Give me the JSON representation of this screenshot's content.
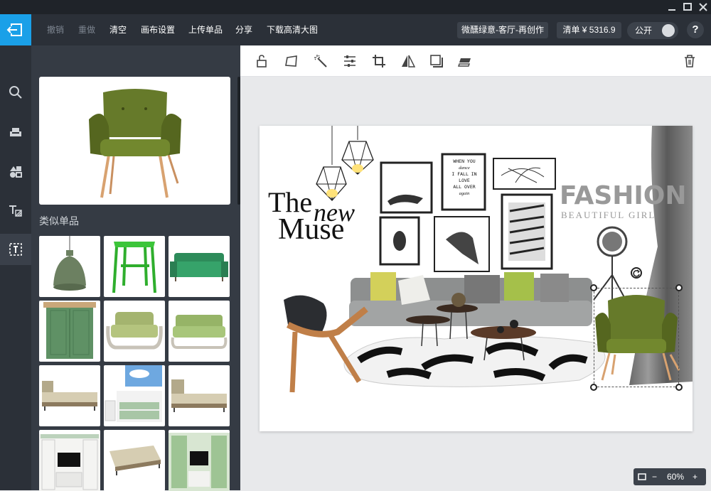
{
  "window": {
    "minimize_icon": "minimize-icon",
    "maximize_icon": "maximize-icon",
    "close_icon": "close-icon"
  },
  "toolbar": {
    "undo": "撤销",
    "redo": "重做",
    "clear": "清空",
    "canvas_settings": "画布设置",
    "upload_item": "上传单品",
    "share": "分享",
    "download_hd": "下载高清大图",
    "project_name": "微醺绿意-客厅-再创作",
    "bill": "清单 ¥ 5316.9",
    "public_label": "公开",
    "help": "?"
  },
  "rail": {
    "items": [
      "search-icon",
      "sofa-icon",
      "materials-icon",
      "text-style-icon",
      "text-box-icon"
    ],
    "active_index": 4
  },
  "panel": {
    "section_title": "类似单品",
    "thumbnails": [
      "green-pendant-lamp",
      "green-stool",
      "green-sofa",
      "green-wardrobe",
      "green-loveseat",
      "green-bench-sofa",
      "beige-daybed",
      "tv-cabinet-sky",
      "beige-sofa-bed",
      "white-tv-wall-unit",
      "beige-bed-frame",
      "green-tv-wall-unit"
    ]
  },
  "editor_tools": [
    "unlock-icon",
    "transform-icon",
    "magic-wand-icon",
    "adjust-icon",
    "crop-icon",
    "flip-icon",
    "shadow-icon",
    "layer-icon",
    "delete-icon"
  ],
  "board": {
    "headline_1": "The",
    "headline_2": "new",
    "headline_3": "Muse",
    "fashion": "FASHION",
    "beautiful_girl": "BEAUTIFUL GIRL",
    "poster_text_lines": [
      "WHEN YOU",
      "dance",
      "I FALL IN",
      "LOVE",
      "ALL OVER",
      "again"
    ]
  },
  "zoom": {
    "minus": "−",
    "value": "60%",
    "plus": "+"
  },
  "colors": {
    "accent": "#1aa0e8",
    "dark": "#2b3038",
    "panel": "#353b44",
    "olive": "#6b7a2e"
  }
}
